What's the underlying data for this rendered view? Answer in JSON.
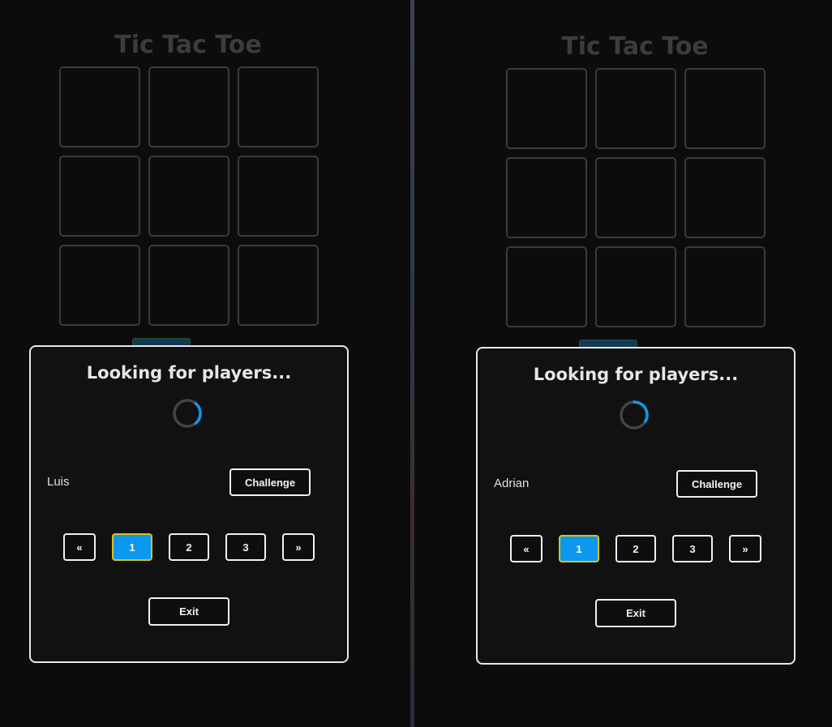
{
  "panes": [
    {
      "title": "Tic Tac Toe",
      "modal": {
        "title": "Looking for players...",
        "player_name": "Luis",
        "challenge_label": "Challenge",
        "pagination": {
          "prev": "«",
          "pages": [
            "1",
            "2",
            "3"
          ],
          "next": "»",
          "active_page": "1"
        },
        "exit_label": "Exit"
      }
    },
    {
      "title": "Tic Tac Toe",
      "modal": {
        "title": "Looking for players...",
        "player_name": "Adrian",
        "challenge_label": "Challenge",
        "pagination": {
          "prev": "«",
          "pages": [
            "1",
            "2",
            "3"
          ],
          "next": "»",
          "active_page": "1"
        },
        "exit_label": "Exit"
      }
    }
  ],
  "colors": {
    "background": "#0c0c0c",
    "cell_border": "#3b3b3b",
    "modal_border": "#e8e8e8",
    "accent": "#0d98f0",
    "active_border": "#d8c21c"
  }
}
